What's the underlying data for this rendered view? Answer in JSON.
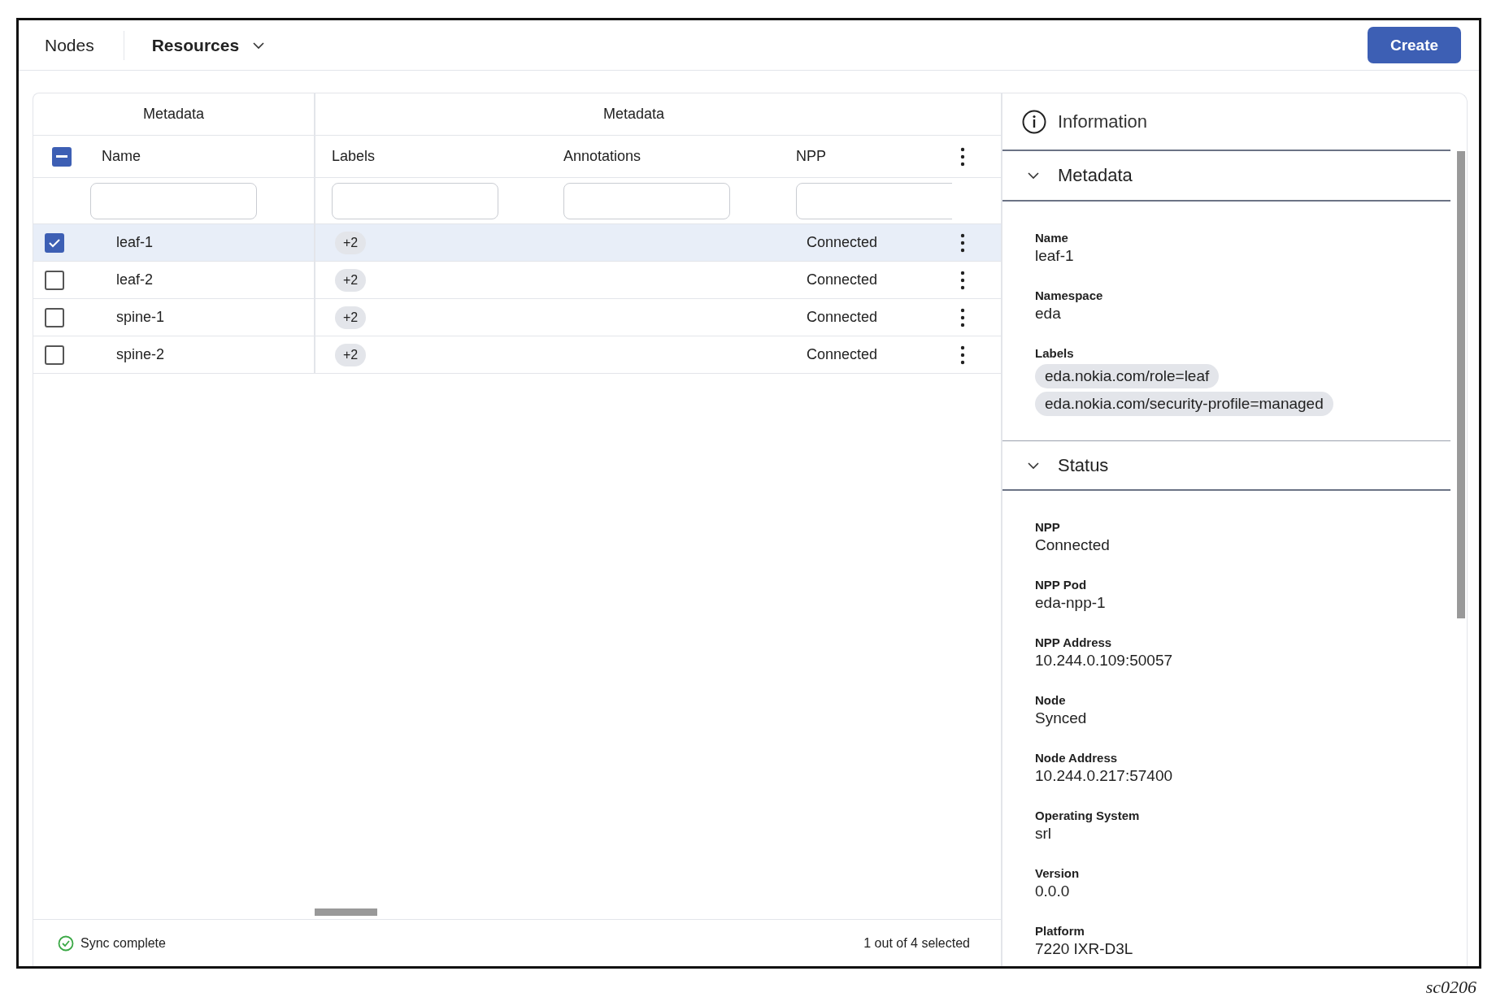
{
  "top_nav": {
    "tabs": [
      {
        "label": "Nodes",
        "selected": false,
        "kind": "link"
      },
      {
        "label": "Resources",
        "selected": true,
        "kind": "dropdown"
      }
    ],
    "create_button": "Create"
  },
  "table": {
    "column_groups": [
      "Metadata",
      "Metadata"
    ],
    "select_all": {
      "indeterminate": true
    },
    "columns": [
      "Name",
      "Labels",
      "Annotations",
      "NPP"
    ],
    "rows": [
      {
        "selected": true,
        "name": "leaf-1",
        "labels": "+2",
        "npp": "Connected"
      },
      {
        "selected": false,
        "name": "leaf-2",
        "labels": "+2",
        "npp": "Connected"
      },
      {
        "selected": false,
        "name": "spine-1",
        "labels": "+2",
        "npp": "Connected"
      },
      {
        "selected": false,
        "name": "spine-2",
        "labels": "+2",
        "npp": "Connected"
      }
    ],
    "footer": {
      "sync_status": "Sync complete",
      "selection_count": "1 out of 4 selected"
    }
  },
  "info_panel": {
    "title": "Information",
    "sections": [
      {
        "title": "Metadata",
        "expanded": true,
        "fields": [
          {
            "kind": "text",
            "label": "Name",
            "value": "leaf-1"
          },
          {
            "kind": "text",
            "label": "Namespace",
            "value": "eda"
          },
          {
            "kind": "tags",
            "label": "Labels",
            "values": [
              "eda.nokia.com/role=leaf",
              "eda.nokia.com/security-profile=managed"
            ]
          }
        ]
      },
      {
        "title": "Status",
        "expanded": true,
        "fields": [
          {
            "kind": "text",
            "label": "NPP",
            "value": "Connected"
          },
          {
            "kind": "text",
            "label": "NPP Pod",
            "value": "eda-npp-1"
          },
          {
            "kind": "text",
            "label": "NPP Address",
            "value": "10.244.0.109:50057"
          },
          {
            "kind": "text",
            "label": "Node",
            "value": "Synced"
          },
          {
            "kind": "text",
            "label": "Node Address",
            "value": "10.244.0.217:57400"
          },
          {
            "kind": "text",
            "label": "Operating System",
            "value": "srl"
          },
          {
            "kind": "text",
            "label": "Version",
            "value": "0.0.0"
          },
          {
            "kind": "text",
            "label": "Platform",
            "value": "7220 IXR-D3L"
          }
        ]
      }
    ]
  },
  "figure_label": "sc0206"
}
